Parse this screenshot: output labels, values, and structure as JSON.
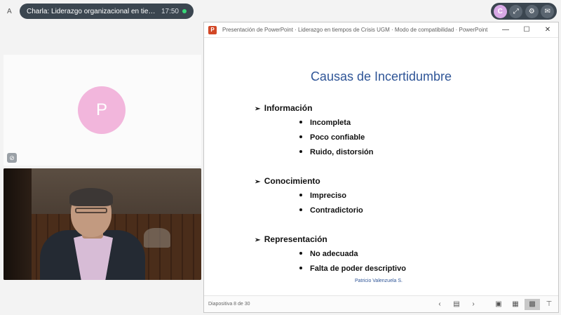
{
  "meeting": {
    "side_letter": "A",
    "title": "Charla: Liderazgo organizacional en tiempos de Crisis",
    "time": "17:50"
  },
  "controls": {
    "avatar_letter": "C"
  },
  "participant": {
    "avatar_letter": "P"
  },
  "ppt": {
    "window_title": "Presentación de PowerPoint · Liderazgo en tiempos de Crisis UGM · Modo de compatibilidad · PowerPoint",
    "minimize": "—",
    "maximize": "☐",
    "close": "✕",
    "slide": {
      "title": "Causas de Incertidumbre",
      "sections": [
        {
          "label": "Información",
          "items": [
            "Incompleta",
            "Poco confiable",
            "Ruido, distorsión"
          ]
        },
        {
          "label": "Conocimiento",
          "items": [
            "Impreciso",
            "Contradictorio"
          ]
        },
        {
          "label": "Representación",
          "items": [
            "No adecuada",
            "Falta de poder descriptivo"
          ]
        }
      ],
      "author": "Patricio Valenzuela S."
    },
    "status": {
      "slide_count": "Diapositiva 8 de 30"
    }
  }
}
